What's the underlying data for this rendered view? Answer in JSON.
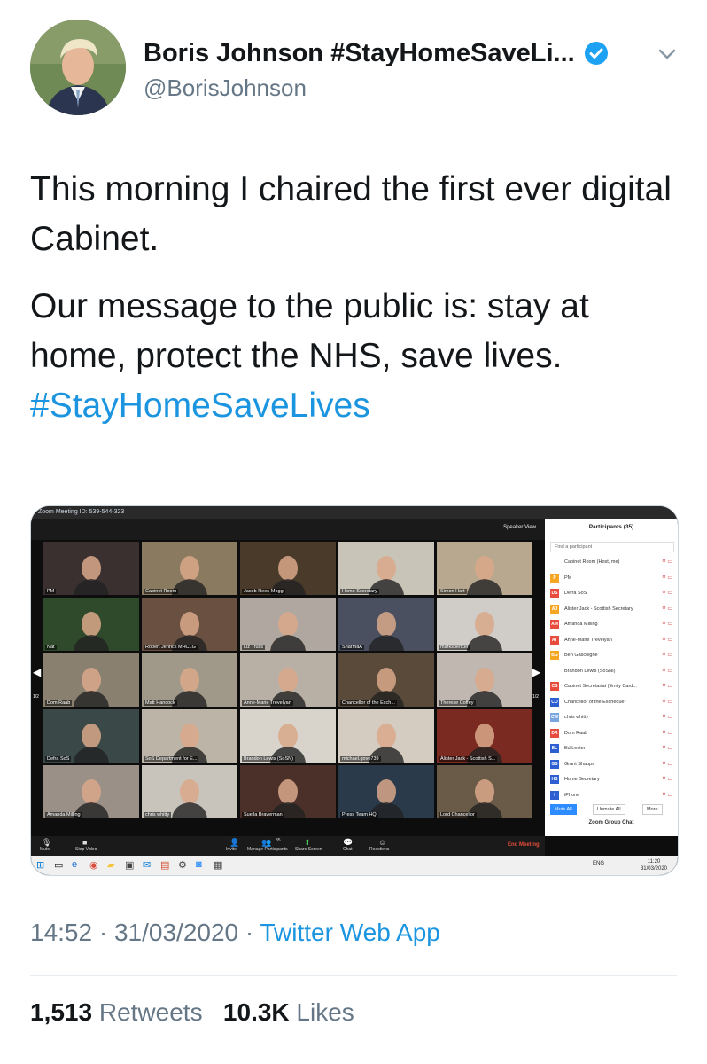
{
  "header": {
    "display_name": "Boris Johnson #StayHomeSaveLi...",
    "handle": "@BorisJohnson"
  },
  "tweet": {
    "paragraph1": "This morning I chaired the first ever digital Cabinet.",
    "paragraph2": "Our message to the public is: stay at home, protect the NHS, save lives.",
    "hashtag": "#StayHomeSaveLives"
  },
  "zoom": {
    "window_title": "Zoom Meeting ID: 539-544-323",
    "speaker_view": "Speaker View",
    "tiles": [
      {
        "label": "PM",
        "color": "#3a3030"
      },
      {
        "label": "Cabinet Room",
        "color": "#8a7a60"
      },
      {
        "label": "Jacob Rees-Mogg",
        "color": "#4a3a2a"
      },
      {
        "label": "Home Secretary",
        "color": "#c9c4b8"
      },
      {
        "label": "Simon Hart",
        "color": "#b8a890"
      },
      {
        "label": "Nat",
        "color": "#2e4a2a"
      },
      {
        "label": "Robert Jenrick MHCLG",
        "color": "#6a5040"
      },
      {
        "label": "Liz Truss",
        "color": "#b0a8a0"
      },
      {
        "label": "SharmaA",
        "color": "#4a5060"
      },
      {
        "label": "markspencer",
        "color": "#d0ccc8"
      },
      {
        "label": "Dom Raab",
        "color": "#8a8070"
      },
      {
        "label": "Matt Hancock",
        "color": "#a09888"
      },
      {
        "label": "Anne-Marie Trevelyan",
        "color": "#b8b0a4"
      },
      {
        "label": "Chancellor of the Exch...",
        "color": "#5a4a3a"
      },
      {
        "label": "Therese Coffey",
        "color": "#c0b8b0"
      },
      {
        "label": "Defra SoS",
        "color": "#3a4848"
      },
      {
        "label": "SoS Department for E...",
        "color": "#bcb4a6"
      },
      {
        "label": "Brandon Lewis (SoSN)",
        "color": "#d8d4cc"
      },
      {
        "label": "michael.gove739",
        "color": "#d4ccc0"
      },
      {
        "label": "Alister Jack - Scottish S...",
        "color": "#7a2a20"
      },
      {
        "label": "Amanda Milling",
        "color": "#9a9088"
      },
      {
        "label": "chris whitty",
        "color": "#c8c4bc"
      },
      {
        "label": "Suella Braverman",
        "color": "#4a3028"
      },
      {
        "label": "Press Team HQ",
        "color": "#2a3a4a"
      },
      {
        "label": "Lord Chancellor",
        "color": "#6a5a48"
      }
    ],
    "page_left": "1/2",
    "page_right": "1/2",
    "panel": {
      "title": "Participants (35)",
      "search_placeholder": "Find a participant",
      "participants": [
        {
          "initials": "",
          "name": "Cabinet Room (Host, me)",
          "color": "#ffffff"
        },
        {
          "initials": "P",
          "name": "PM",
          "color": "#f5a623"
        },
        {
          "initials": "DS",
          "name": "Defra SoS",
          "color": "#e74c3c"
        },
        {
          "initials": "AJ",
          "name": "Alister Jack - Scottish Secretary",
          "color": "#f5a623"
        },
        {
          "initials": "AM",
          "name": "Amanda Milling",
          "color": "#e74c3c"
        },
        {
          "initials": "AT",
          "name": "Anne-Marie Trevelyan",
          "color": "#e74c3c"
        },
        {
          "initials": "BG",
          "name": "Ben Gascoigne",
          "color": "#f5a623"
        },
        {
          "initials": "",
          "name": "Brandon Lewis (SoSNI)",
          "color": "#ffffff"
        },
        {
          "initials": "CS",
          "name": "Cabinet Secretariat (Emily Card...",
          "color": "#e74c3c"
        },
        {
          "initials": "CO",
          "name": "Chancellor of the Exchequer",
          "color": "#2d5fd0"
        },
        {
          "initials": "CW",
          "name": "chris whitty",
          "color": "#7aa6e0"
        },
        {
          "initials": "DR",
          "name": "Dom Raab",
          "color": "#e74c3c"
        },
        {
          "initials": "EL",
          "name": "Ed Lester",
          "color": "#2d5fd0"
        },
        {
          "initials": "GS",
          "name": "Grant Shapps",
          "color": "#2d5fd0"
        },
        {
          "initials": "HS",
          "name": "Home Secretary",
          "color": "#2d5fd0"
        },
        {
          "initials": "I",
          "name": "iPhone",
          "color": "#2d5fd0"
        }
      ],
      "mute_all": "Mute All",
      "unmute_all": "Unmute All",
      "more": "More",
      "group_chat": "Zoom Group Chat"
    },
    "toolbar": {
      "mute": "Mute",
      "stop_video": "Stop Video",
      "invite": "Invite",
      "manage_participants": "Manage Participants",
      "participants_count": "35",
      "share_screen": "Share Screen",
      "chat": "Chat",
      "reactions": "Reactions",
      "end_meeting": "End Meeting"
    },
    "taskbar": {
      "lang": "ENG",
      "time": "11:20",
      "date": "31/03/2020"
    }
  },
  "meta": {
    "time": "14:52",
    "date": "31/03/2020",
    "separator": "·",
    "source": "Twitter Web App"
  },
  "stats": {
    "retweets_count": "1,513",
    "retweets_label": "Retweets",
    "likes_count": "10.3K",
    "likes_label": "Likes"
  },
  "colors": {
    "link": "#1b95e0",
    "secondary_text": "#657786",
    "verified": "#1da1f2"
  }
}
